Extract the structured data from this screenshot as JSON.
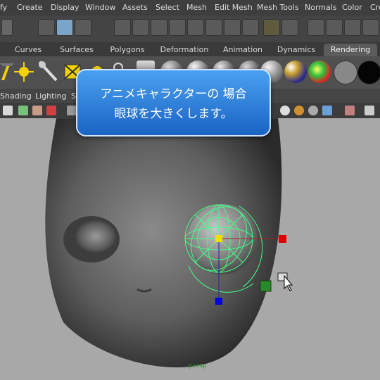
{
  "menubar": {
    "items": [
      "fy",
      "Create",
      "Display",
      "Window",
      "Assets",
      "Select",
      "Mesh",
      "Edit Mesh",
      "Mesh Tools",
      "Normals",
      "Color",
      "Cre"
    ]
  },
  "shelf_tabs": {
    "items": [
      "Curves",
      "Surfaces",
      "Polygons",
      "Deformation",
      "Animation",
      "Dynamics",
      "Rendering"
    ],
    "active": "Rendering"
  },
  "panel_menu": {
    "items": [
      "Shading",
      "Lighting",
      "S"
    ]
  },
  "tooltip": {
    "line1": "アニメキャラクターの 場合",
    "line2": "眼球を大きくします。"
  },
  "viewport": {
    "camera_label": "persp"
  },
  "colors": {
    "manipulator": "#44ff88",
    "bubble_top": "#4aa0f0",
    "bubble_bottom": "#1a64c4",
    "x_axis": "#e00000",
    "y_axis": "#f0e000",
    "z_axis": "#0000e0"
  },
  "icons": [
    "menu-arrow-icon",
    "select-tool-icon",
    "lasso-icon",
    "snap-grid-icon",
    "snap-curve-icon",
    "snap-point-icon",
    "question-icon",
    "lock-icon",
    "magnet-icon",
    "spotlight-icon",
    "directional-light-icon",
    "camera-icon",
    "move-manipulator-icon",
    "cursor-icon"
  ]
}
